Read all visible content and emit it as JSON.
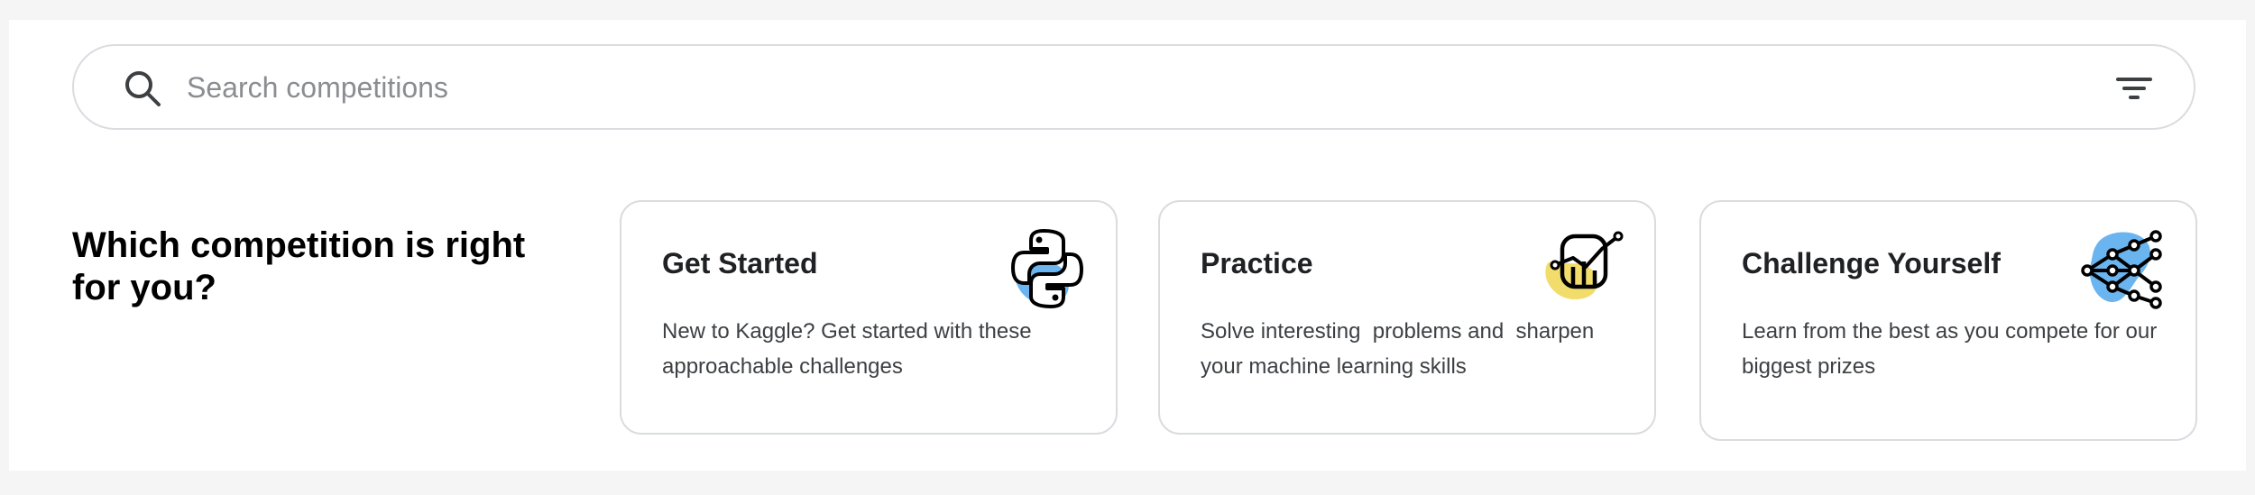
{
  "search": {
    "placeholder": "Search competitions",
    "value": ""
  },
  "section": {
    "headline": "Which competition is right for you?"
  },
  "cards": [
    {
      "title": "Get Started",
      "description": "New to Kaggle? Get started with these approachable challenges",
      "icon": "python-logo-icon",
      "blob_color": "#6ab4f0"
    },
    {
      "title": "Practice",
      "description": "Solve interesting  problems and  sharpen your machine learning skills",
      "icon": "chart-robot-icon",
      "blob_color": "#f2dc6b"
    },
    {
      "title": "Challenge Yourself",
      "description": "Learn from the best as you compete for our biggest prizes",
      "icon": "network-graph-icon",
      "blob_color": "#6ab4f0"
    }
  ],
  "colors": {
    "page_background": "#f5f5f5",
    "panel_background": "#ffffff",
    "border": "#dadce0",
    "text_primary": "#202124",
    "placeholder": "#8a8d91"
  }
}
